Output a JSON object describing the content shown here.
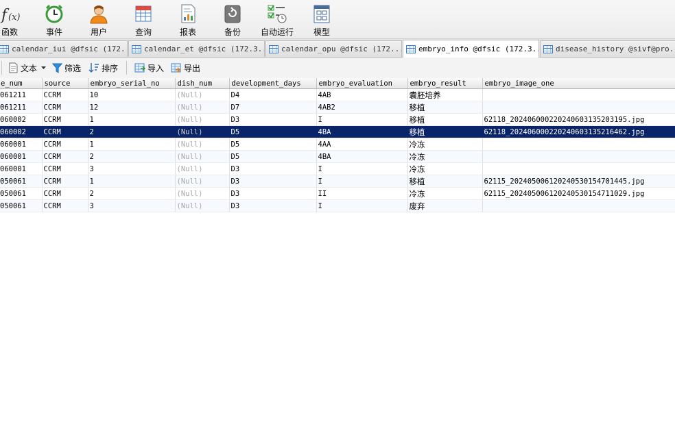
{
  "ribbon": {
    "items": [
      {
        "label": "函数",
        "icon": "function-icon"
      },
      {
        "label": "事件",
        "icon": "alarm-clock-icon"
      },
      {
        "label": "用户",
        "icon": "user-icon"
      },
      {
        "label": "查询",
        "icon": "query-icon"
      },
      {
        "label": "报表",
        "icon": "report-icon"
      },
      {
        "label": "备份",
        "icon": "backup-icon"
      },
      {
        "label": "自动运行",
        "icon": "automation-icon"
      },
      {
        "label": "模型",
        "icon": "model-icon"
      }
    ]
  },
  "tabs": [
    {
      "label": "calendar_iui @dfsic (172...."
    },
    {
      "label": "calendar_et @dfsic (172.3..."
    },
    {
      "label": "calendar_opu @dfsic (172...."
    },
    {
      "label": "embryo_info @dfsic (172.3..."
    },
    {
      "label": "disease_history @sivf@pro..."
    }
  ],
  "active_tab_index": 3,
  "toolbar": {
    "text_label": "文本",
    "filter_label": "筛选",
    "sort_label": "排序",
    "import_label": "导入",
    "export_label": "导出"
  },
  "grid": {
    "columns": [
      "e_num",
      "source",
      "embryo_serial_no",
      "dish_num",
      "development_days",
      "embryo_evaluation",
      "embryo_result",
      "embryo_image_one"
    ],
    "selected_row_index": 3,
    "rows": [
      [
        "061211",
        "CCRM",
        "10",
        "(Null)",
        "D4",
        "4AB",
        "囊胚培养",
        ""
      ],
      [
        "061211",
        "CCRM",
        "12",
        "(Null)",
        "D7",
        "4AB2",
        "移植",
        ""
      ],
      [
        "060002",
        "CCRM",
        "1",
        "(Null)",
        "D3",
        "I",
        "移植",
        "62118_20240600022024060313520319​5.jpg"
      ],
      [
        "060002",
        "CCRM",
        "2",
        "(Null)",
        "D5",
        "4BA",
        "移植",
        "62118_202406000220240603135216462.jpg"
      ],
      [
        "060001",
        "CCRM",
        "1",
        "(Null)",
        "D5",
        "4AA",
        "冷冻",
        ""
      ],
      [
        "060001",
        "CCRM",
        "2",
        "(Null)",
        "D5",
        "4BA",
        "冷冻",
        ""
      ],
      [
        "060001",
        "CCRM",
        "3",
        "(Null)",
        "D3",
        "I",
        "冷冻",
        ""
      ],
      [
        "050061",
        "CCRM",
        "1",
        "(Null)",
        "D3",
        "I",
        "移植",
        "62115_202405006120240530154701445.jpg"
      ],
      [
        "050061",
        "CCRM",
        "2",
        "(Null)",
        "D3",
        "II",
        "冷冻",
        "62115_202405006120240530154711029.jpg"
      ],
      [
        "050061",
        "CCRM",
        "3",
        "(Null)",
        "D3",
        "I",
        "废弃",
        ""
      ]
    ]
  }
}
